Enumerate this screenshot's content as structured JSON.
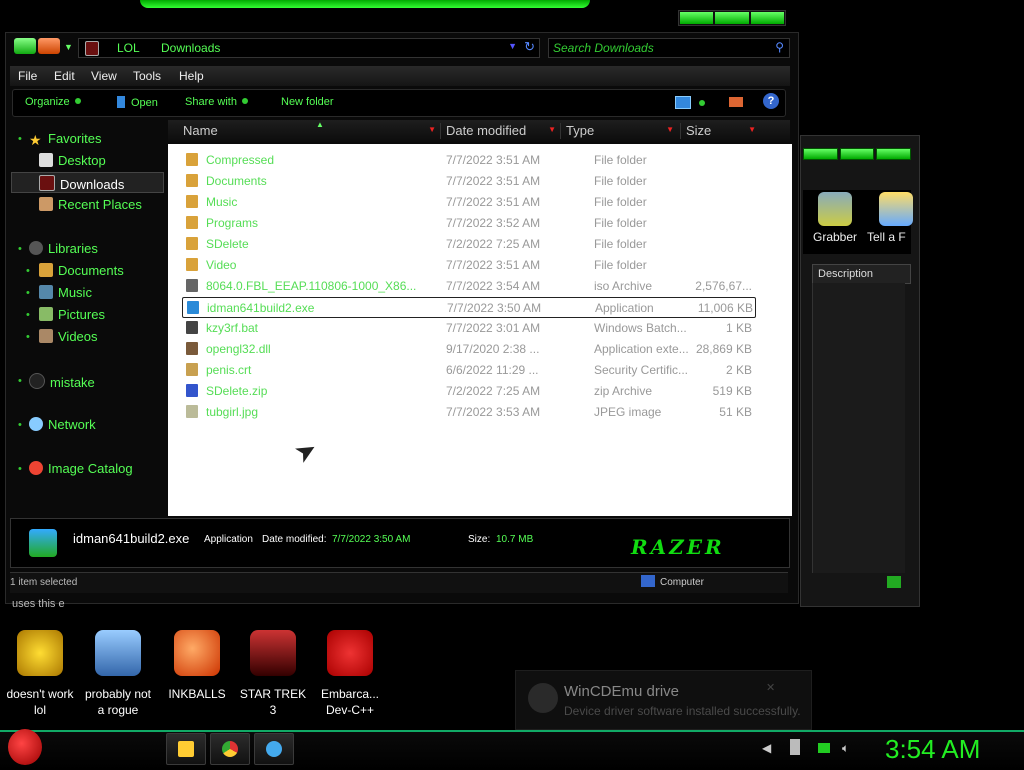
{
  "window": {
    "address": {
      "crumbs": [
        "LOL",
        "Downloads"
      ]
    },
    "search": {
      "placeholder": "Search Downloads"
    },
    "menu": [
      "File",
      "Edit",
      "View",
      "Tools",
      "Help"
    ],
    "commands": {
      "organize": "Organize",
      "open": "Open",
      "share": "Share with",
      "new_folder": "New folder"
    },
    "nav": {
      "favorites": "Favorites",
      "desktop": "Desktop",
      "downloads": "Downloads",
      "recent": "Recent Places",
      "libraries": "Libraries",
      "documents": "Documents",
      "music": "Music",
      "pictures": "Pictures",
      "videos": "Videos",
      "mistake": "mistake",
      "network": "Network",
      "image_catalog": "Image Catalog"
    },
    "columns": {
      "name": "Name",
      "date": "Date modified",
      "type": "Type",
      "size": "Size"
    },
    "files": [
      {
        "name": "Compressed",
        "date": "7/7/2022 3:51 AM",
        "type": "File folder",
        "size": "",
        "icon": "folder-icon",
        "color": "#d9a23a"
      },
      {
        "name": "Documents",
        "date": "7/7/2022 3:51 AM",
        "type": "File folder",
        "size": "",
        "icon": "folder-icon",
        "color": "#d9a23a"
      },
      {
        "name": "Music",
        "date": "7/7/2022 3:51 AM",
        "type": "File folder",
        "size": "",
        "icon": "folder-icon",
        "color": "#d9a23a"
      },
      {
        "name": "Programs",
        "date": "7/7/2022 3:52 AM",
        "type": "File folder",
        "size": "",
        "icon": "folder-icon",
        "color": "#d9a23a"
      },
      {
        "name": "SDelete",
        "date": "7/2/2022 7:25 AM",
        "type": "File folder",
        "size": "",
        "icon": "folder-icon",
        "color": "#d9a23a"
      },
      {
        "name": "Video",
        "date": "7/7/2022 3:51 AM",
        "type": "File folder",
        "size": "",
        "icon": "folder-icon",
        "color": "#d9a23a"
      },
      {
        "name": "8064.0.FBL_EEAP.110806-1000_X86...",
        "date": "7/7/2022 3:54 AM",
        "type": "iso Archive",
        "size": "2,576,67...",
        "icon": "iso-icon",
        "color": "#666666"
      },
      {
        "name": "idman641build2.exe",
        "date": "7/7/2022 3:50 AM",
        "type": "Application",
        "size": "11,006 KB",
        "icon": "exe-icon",
        "color": "#2a8ad8"
      },
      {
        "name": "kzy3rf.bat",
        "date": "7/7/2022 3:01 AM",
        "type": "Windows Batch...",
        "size": "1 KB",
        "icon": "bat-icon",
        "color": "#444444"
      },
      {
        "name": "opengl32.dll",
        "date": "9/17/2020 2:38 ...",
        "type": "Application exte...",
        "size": "28,869 KB",
        "icon": "dll-icon",
        "color": "#7a5a3a"
      },
      {
        "name": "penis.crt",
        "date": "6/6/2022 11:29 ...",
        "type": "Security Certific...",
        "size": "2 KB",
        "icon": "certificate-icon",
        "color": "#c8a050"
      },
      {
        "name": "SDelete.zip",
        "date": "7/2/2022 7:25 AM",
        "type": "zip Archive",
        "size": "519 KB",
        "icon": "zip-icon",
        "color": "#3355cc"
      },
      {
        "name": "tubgirl.jpg",
        "date": "7/7/2022 3:53 AM",
        "type": "JPEG image",
        "size": "51 KB",
        "icon": "image-icon",
        "color": "#bbbb99"
      }
    ],
    "details": {
      "name": "idman641build2.exe",
      "type": "Application",
      "date_label": "Date modified:",
      "date": "7/7/2022 3:50 AM",
      "size_label": "Size:",
      "size": "10.7 MB",
      "logo": "RAZER"
    },
    "status": {
      "left": "1 item selected",
      "right": "Computer"
    }
  },
  "bg_window": {
    "tool1": "Grabber",
    "tool2": "Tell a F",
    "desc": "Description"
  },
  "behind_text": "uses this      e",
  "desktop_icons": [
    {
      "line1": "doesn't work",
      "line2": "lol",
      "icon": "yahoo-messenger-icon"
    },
    {
      "line1": "probably not",
      "line2": "a rogue",
      "icon": "gear-monitor-icon"
    },
    {
      "line1": "INKBALLS",
      "line2": "",
      "icon": "inkball-icon"
    },
    {
      "line1": "STAR TREK",
      "line2": "3",
      "icon": "star-trek-icon"
    },
    {
      "line1": "Embarca...",
      "line2": "Dev-C++",
      "icon": "dev-cpp-icon"
    }
  ],
  "notification": {
    "title": "WinCDEmu drive",
    "body": "Device driver software installed successfully."
  },
  "taskbar": {
    "clock": "3:54 AM"
  },
  "colors": {
    "accent": "#33dd33",
    "selected_row": "#222222"
  }
}
